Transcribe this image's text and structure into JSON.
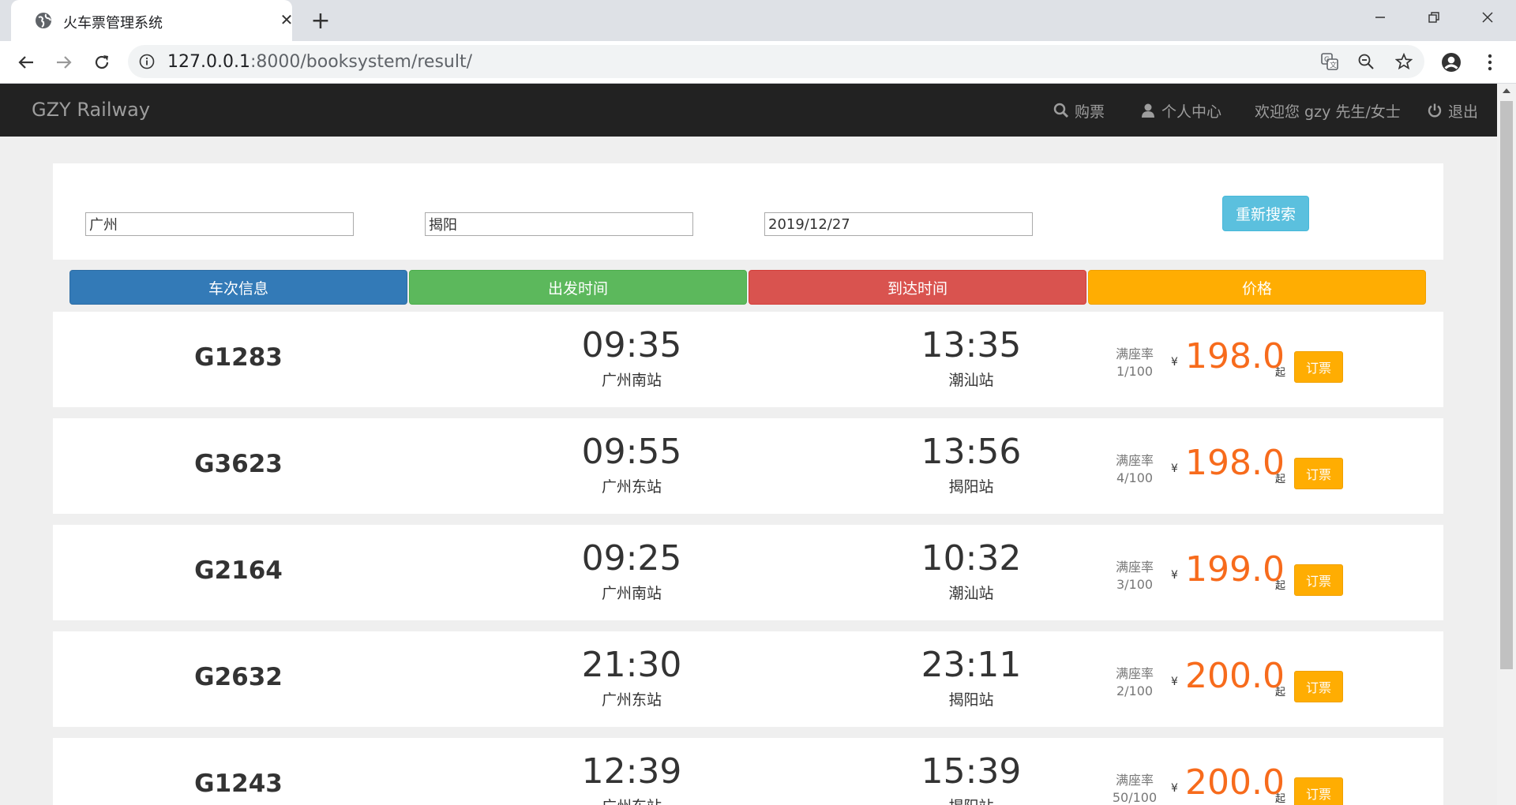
{
  "browser": {
    "tab_title": "火车票管理系统",
    "url_host": "127.0.0.1",
    "url_rest": ":8000/booksystem/result/"
  },
  "navbar": {
    "brand": "GZY Railway",
    "buy_label": "购票",
    "profile_label": "个人中心",
    "welcome": "欢迎您 gzy 先生/女士",
    "logout_label": "退出"
  },
  "search": {
    "from": "广州",
    "to": "揭阳",
    "date": "2019/12/27",
    "button": "重新搜索"
  },
  "headers": {
    "train": "车次信息",
    "depart": "出发时间",
    "arrive": "到达时间",
    "price": "价格"
  },
  "colors": {
    "header_train": "#337ab7",
    "header_depart": "#5cb85c",
    "header_arrive": "#d9534f",
    "header_price": "#ffad02",
    "price_text": "#f76b1c",
    "book_button": "#ffad02"
  },
  "labels": {
    "seat_rate": "满座率",
    "yen": "¥",
    "qi": "起",
    "book": "订票"
  },
  "trains": [
    {
      "no": "G1283",
      "depart": "09:35",
      "from_station": "广州南站",
      "arrive": "13:35",
      "to_station": "潮汕站",
      "seat": "1/100",
      "price": "198.0"
    },
    {
      "no": "G3623",
      "depart": "09:55",
      "from_station": "广州东站",
      "arrive": "13:56",
      "to_station": "揭阳站",
      "seat": "4/100",
      "price": "198.0"
    },
    {
      "no": "G2164",
      "depart": "09:25",
      "from_station": "广州南站",
      "arrive": "10:32",
      "to_station": "潮汕站",
      "seat": "3/100",
      "price": "199.0"
    },
    {
      "no": "G2632",
      "depart": "21:30",
      "from_station": "广州东站",
      "arrive": "23:11",
      "to_station": "揭阳站",
      "seat": "2/100",
      "price": "200.0"
    },
    {
      "no": "G1243",
      "depart": "12:39",
      "from_station": "广州东站",
      "arrive": "15:39",
      "to_station": "揭阳站",
      "seat": "50/100",
      "price": "200.0"
    }
  ]
}
